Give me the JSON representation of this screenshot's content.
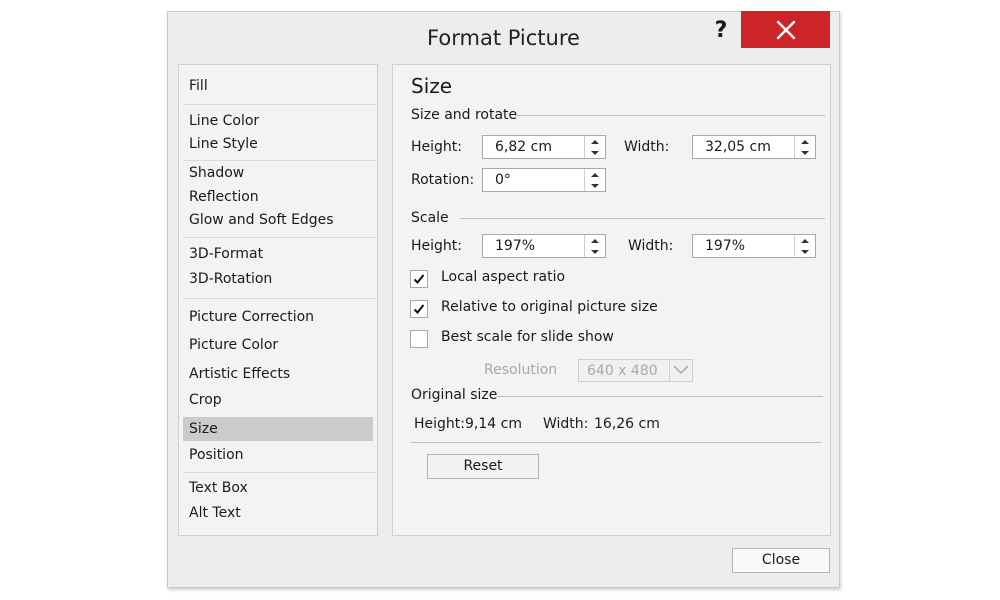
{
  "dialog": {
    "title": "Format Picture",
    "help_label": "?",
    "close_label": "Close"
  },
  "nav": {
    "items": [
      "Fill",
      "Line Color",
      "Line Style",
      "Shadow",
      "Reflection",
      "Glow and Soft Edges",
      "3D-Format",
      "3D-Rotation",
      "Picture Correction",
      "Picture Color",
      "Artistic Effects",
      "Crop",
      "Size",
      "Position",
      "Text Box",
      "Alt Text"
    ],
    "selected": "Size"
  },
  "size_panel": {
    "heading": "Size",
    "size_and_rotate": {
      "label": "Size and rotate",
      "height_label": "Height:",
      "height_value": "6,82 cm",
      "width_label": "Width:",
      "width_value": "32,05 cm",
      "rotation_label": "Rotation:",
      "rotation_value": "0°"
    },
    "scale": {
      "label": "Scale",
      "height_label": "Height:",
      "height_value": "197%",
      "width_label": "Width:",
      "width_value": "197%",
      "lock_aspect_ratio_label": "Local aspect ratio",
      "lock_aspect_ratio_checked": true,
      "relative_label": "Relative to original picture size",
      "relative_checked": true,
      "best_scale_label": "Best scale for slide show",
      "best_scale_checked": false,
      "resolution_label": "Resolution",
      "resolution_value": "640 x 480"
    },
    "original_size": {
      "label": "Original size",
      "height_label": "Height:",
      "height_value": "9,14 cm",
      "width_label": "Width:",
      "width_value": "16,26 cm"
    },
    "reset_label": "Reset"
  },
  "icons": {
    "close": "close-x-icon",
    "spin_up": "chevron-up-icon",
    "spin_down": "chevron-down-icon",
    "checkmark": "checkmark-icon",
    "dropdown": "chevron-down-icon"
  },
  "colors": {
    "close_button": "#cd2428",
    "selected_item": "#cbcbcb",
    "dialog_bg": "#ededed",
    "panel_bg": "#f3f3f3"
  }
}
